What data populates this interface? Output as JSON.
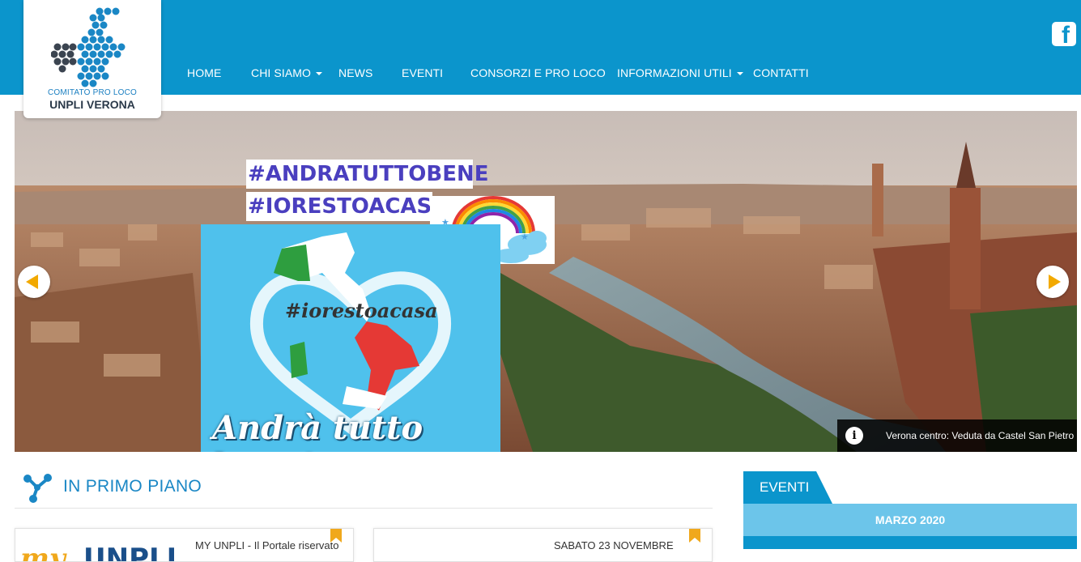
{
  "header": {
    "logo": {
      "subtitle": "COMITATO PRO LOCO",
      "title": "UNPLI VERONA"
    },
    "nav": [
      {
        "label": "HOME",
        "has_submenu": false
      },
      {
        "label": "CHI SIAMO",
        "has_submenu": true
      },
      {
        "label": "NEWS",
        "has_submenu": false
      },
      {
        "label": "EVENTI",
        "has_submenu": false
      },
      {
        "label": "CONSORZI E PRO LOCO",
        "has_submenu": false
      },
      {
        "label": "INFORMAZIONI UTILI",
        "has_submenu": true
      },
      {
        "label": "CONTATTI",
        "has_submenu": false
      }
    ],
    "social_icon": "facebook-icon"
  },
  "slider": {
    "hashtag1": "#ANDRATUTTOBENE",
    "hashtag2": "#IORESTOACASA",
    "poster_tag": "#iorestoacasa",
    "poster_slogan": "Andrà tutto bene!",
    "caption": "Verona centro: Veduta da Castel San Pietro",
    "prev_icon": "arrow-left-icon",
    "next_icon": "arrow-right-icon"
  },
  "in_primo_piano": {
    "title": "IN PRIMO PIANO",
    "cards": [
      {
        "text": "MY UNPLI - Il Portale riservato"
      },
      {
        "text": "SABATO 23 NOVEMBRE"
      }
    ]
  },
  "eventi": {
    "title": "EVENTI",
    "month": "MARZO 2020"
  },
  "colors": {
    "header_blue": "#0b95cc",
    "accent_orange": "#f2a900",
    "hashtag_purple": "#4a3fbf",
    "light_blue": "#6cc5ea"
  }
}
